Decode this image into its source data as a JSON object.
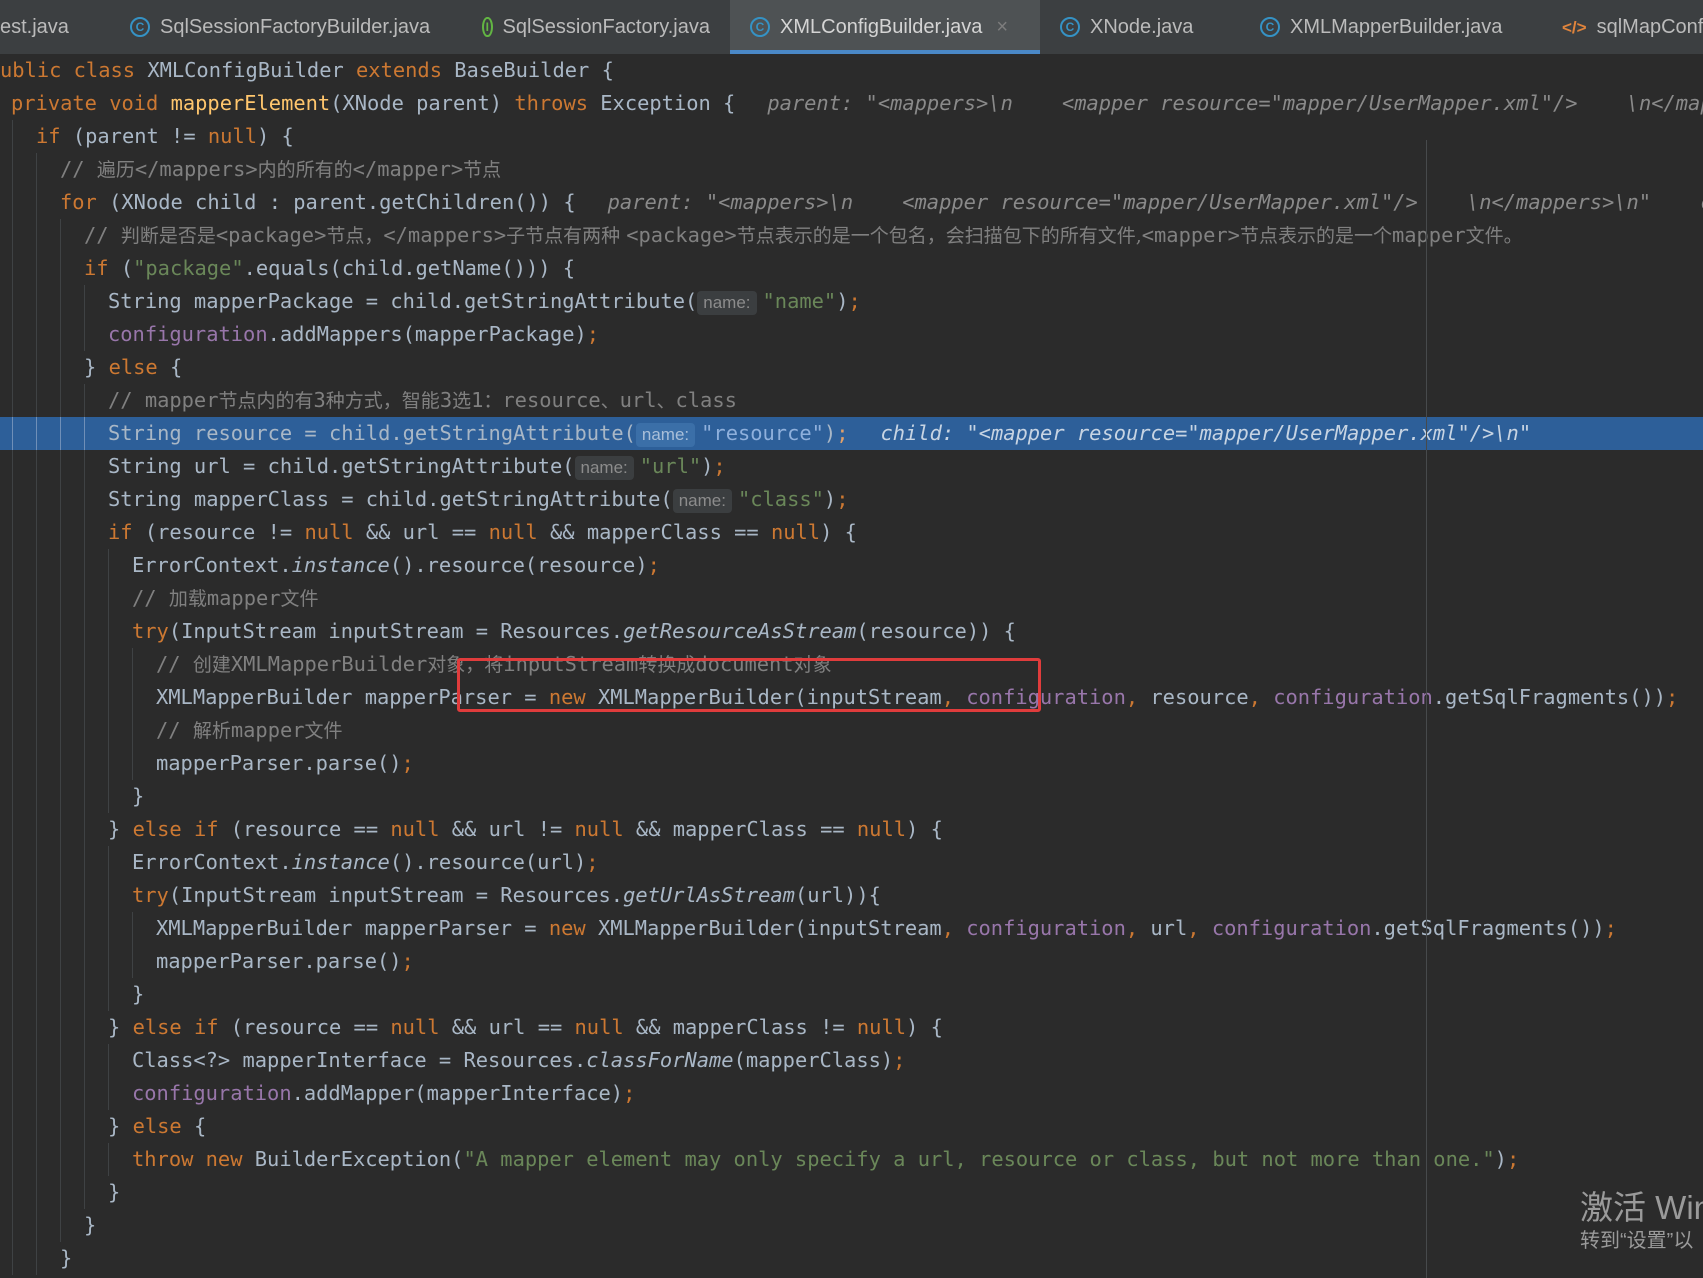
{
  "tabs": [
    {
      "label": "est.java",
      "icon": "none"
    },
    {
      "label": "SqlSessionFactoryBuilder.java",
      "icon": "class-icon"
    },
    {
      "label": "SqlSessionFactory.java",
      "icon": "interface-icon"
    },
    {
      "label": "XMLConfigBuilder.java",
      "icon": "class-icon",
      "active": true,
      "close": "×"
    },
    {
      "label": "XNode.java",
      "icon": "class-icon"
    },
    {
      "label": "XMLMapperBuilder.java",
      "icon": "class-icon"
    },
    {
      "label": "sqlMapConfig",
      "icon": "xml-icon"
    }
  ],
  "icon_glyphs": {
    "class-icon": "C",
    "interface-icon": "I",
    "xml-icon": "</>"
  },
  "highlight_color": "#2d5f99",
  "marker_color": "#e03c3c",
  "code_lines": [
    [
      [
        "kw",
        "ublic class "
      ],
      [
        "t",
        "XMLConfigBuilder "
      ],
      [
        "kw",
        "extends "
      ],
      [
        "t",
        "BaseBuilder {"
      ]
    ],
    [
      [
        "kw",
        "private void "
      ],
      [
        "fn",
        "mapperElement"
      ],
      [
        "t",
        "(XNode parent) "
      ],
      [
        "kw",
        "throws "
      ],
      [
        "t",
        "Exception {"
      ],
      [
        "inl",
        "parent: \"<mappers>\\n    <mapper resource=\"mapper/UserMapper.xml\"/>    \\n</mappers>\\n\""
      ]
    ],
    [
      [
        "kw",
        "if "
      ],
      [
        "t",
        "(parent != "
      ],
      [
        "kw",
        "null"
      ],
      [
        "t",
        ") {"
      ]
    ],
    [
      [
        "cm",
        "// "
      ],
      [
        "cmz",
        "遍历"
      ],
      [
        "cm",
        "</mappers>"
      ],
      [
        "cmz",
        "内的所有的"
      ],
      [
        "cm",
        "</mapper>"
      ],
      [
        "cmz",
        "节点"
      ]
    ],
    [
      [
        "kw",
        "for "
      ],
      [
        "t",
        "(XNode child : parent.getChildren()) {"
      ],
      [
        "inl",
        "parent: \"<mappers>\\n    <mapper resource=\"mapper/UserMapper.xml\"/>    \\n</mappers>\\n\"    child: \"<mapper resource=\"mapper/UserMapper.xml\"/>\\n\""
      ]
    ],
    [
      [
        "cm",
        "// "
      ],
      [
        "cmz",
        "判断是否是"
      ],
      [
        "cm",
        "<package>"
      ],
      [
        "cmz",
        "节点，"
      ],
      [
        "cm",
        "</mappers>"
      ],
      [
        "cmz",
        "子节点有两种 "
      ],
      [
        "cm",
        "<package>"
      ],
      [
        "cmz",
        "节点表示的是一个包名，会扫描包下的所有文件,"
      ],
      [
        "cm",
        "<mapper>"
      ],
      [
        "cmz",
        "节点表示的是一个"
      ],
      [
        "cm",
        "mapper"
      ],
      [
        "cmz",
        "文件。"
      ]
    ],
    [
      [
        "kw",
        "if "
      ],
      [
        "t",
        "("
      ],
      [
        "str",
        "\"package\""
      ],
      [
        "t",
        ".equals(child.getName())) {"
      ]
    ],
    [
      [
        "t",
        "String mapperPackage = child.getStringAttribute("
      ],
      [
        "ph",
        "name:"
      ],
      [
        "str",
        "\"name\""
      ],
      [
        "t",
        ")"
      ],
      [
        "kw",
        ";"
      ]
    ],
    [
      [
        "fld",
        "configuration"
      ],
      [
        "t",
        ".addMappers(mapperPackage)"
      ],
      [
        "kw",
        ";"
      ]
    ],
    [
      [
        "t",
        "} "
      ],
      [
        "kw",
        "else "
      ],
      [
        "t",
        "{"
      ]
    ],
    [
      [
        "cm",
        "// mapper"
      ],
      [
        "cmz",
        "节点内的有"
      ],
      [
        "cm",
        "3"
      ],
      [
        "cmz",
        "种方式，智能"
      ],
      [
        "cm",
        "3"
      ],
      [
        "cmz",
        "选"
      ],
      [
        "cm",
        "1"
      ],
      [
        "cmz",
        "："
      ],
      [
        "cm",
        "resource"
      ],
      [
        "cmz",
        "、"
      ],
      [
        "cm",
        "url"
      ],
      [
        "cmz",
        "、"
      ],
      [
        "cm",
        "class"
      ]
    ],
    [
      [
        "t",
        "String resource = child.getStringAttribute("
      ],
      [
        "ph",
        "name:"
      ],
      [
        "str",
        "\"resource\""
      ],
      [
        "t",
        ")"
      ],
      [
        "kw",
        ";"
      ],
      [
        "inl",
        "child: \"<mapper resource=\"mapper/UserMapper.xml\"/>\\n\""
      ]
    ],
    [
      [
        "t",
        "String url = child.getStringAttribute("
      ],
      [
        "ph",
        "name:"
      ],
      [
        "str",
        "\"url\""
      ],
      [
        "t",
        ")"
      ],
      [
        "kw",
        ";"
      ]
    ],
    [
      [
        "t",
        "String mapperClass = child.getStringAttribute("
      ],
      [
        "ph",
        "name:"
      ],
      [
        "str",
        "\"class\""
      ],
      [
        "t",
        ")"
      ],
      [
        "kw",
        ";"
      ]
    ],
    [
      [
        "kw",
        "if "
      ],
      [
        "t",
        "(resource != "
      ],
      [
        "kw",
        "null "
      ],
      [
        "t",
        "&& url == "
      ],
      [
        "kw",
        "null "
      ],
      [
        "t",
        "&& mapperClass == "
      ],
      [
        "kw",
        "null"
      ],
      [
        "t",
        ") {"
      ]
    ],
    [
      [
        "t",
        "ErrorContext."
      ],
      [
        "it",
        "instance"
      ],
      [
        "t",
        "().resource(resource)"
      ],
      [
        "kw",
        ";"
      ]
    ],
    [
      [
        "cm",
        "// "
      ],
      [
        "cmz",
        "加载"
      ],
      [
        "cm",
        "mapper"
      ],
      [
        "cmz",
        "文件"
      ]
    ],
    [
      [
        "kw",
        "try"
      ],
      [
        "t",
        "(InputStream inputStream = Resources."
      ],
      [
        "it",
        "getResourceAsStream"
      ],
      [
        "t",
        "(resource)) {"
      ]
    ],
    [
      [
        "cm",
        "// "
      ],
      [
        "cmz",
        "创建"
      ],
      [
        "cm",
        "XMLMapperBuilder"
      ],
      [
        "cmz",
        "对象，将"
      ],
      [
        "cm",
        "inputStream"
      ],
      [
        "cmz",
        "转换成"
      ],
      [
        "cm",
        "document"
      ],
      [
        "cmz",
        "对象"
      ]
    ],
    [
      [
        "t",
        "XMLMapperBuilder mapperParser = "
      ],
      [
        "kw",
        "new "
      ],
      [
        "t",
        "XMLMapperBuilder(inputStream"
      ],
      [
        "kw",
        ", "
      ],
      [
        "fld",
        "configuration"
      ],
      [
        "kw",
        ", "
      ],
      [
        "t",
        "resource"
      ],
      [
        "kw",
        ", "
      ],
      [
        "fld",
        "configuration"
      ],
      [
        "t",
        ".getSqlFragments())"
      ],
      [
        "kw",
        ";"
      ]
    ],
    [
      [
        "cm",
        "// "
      ],
      [
        "cmz",
        "解析"
      ],
      [
        "cm",
        "mapper"
      ],
      [
        "cmz",
        "文件"
      ]
    ],
    [
      [
        "t",
        "mapperParser.parse()"
      ],
      [
        "kw",
        ";"
      ]
    ],
    [
      [
        "t",
        "}"
      ]
    ],
    [
      [
        "t",
        "} "
      ],
      [
        "kw",
        "else if "
      ],
      [
        "t",
        "(resource == "
      ],
      [
        "kw",
        "null "
      ],
      [
        "t",
        "&& url != "
      ],
      [
        "kw",
        "null "
      ],
      [
        "t",
        "&& mapperClass == "
      ],
      [
        "kw",
        "null"
      ],
      [
        "t",
        ") {"
      ]
    ],
    [
      [
        "t",
        "ErrorContext."
      ],
      [
        "it",
        "instance"
      ],
      [
        "t",
        "().resource(url)"
      ],
      [
        "kw",
        ";"
      ]
    ],
    [
      [
        "kw",
        "try"
      ],
      [
        "t",
        "(InputStream inputStream = Resources."
      ],
      [
        "it",
        "getUrlAsStream"
      ],
      [
        "t",
        "(url)){"
      ]
    ],
    [
      [
        "t",
        "XMLMapperBuilder mapperParser = "
      ],
      [
        "kw",
        "new "
      ],
      [
        "t",
        "XMLMapperBuilder(inputStream"
      ],
      [
        "kw",
        ", "
      ],
      [
        "fld",
        "configuration"
      ],
      [
        "kw",
        ", "
      ],
      [
        "t",
        "url"
      ],
      [
        "kw",
        ", "
      ],
      [
        "fld",
        "configuration"
      ],
      [
        "t",
        ".getSqlFragments())"
      ],
      [
        "kw",
        ";"
      ]
    ],
    [
      [
        "t",
        "mapperParser.parse()"
      ],
      [
        "kw",
        ";"
      ]
    ],
    [
      [
        "t",
        "}"
      ]
    ],
    [
      [
        "t",
        "} "
      ],
      [
        "kw",
        "else if "
      ],
      [
        "t",
        "(resource == "
      ],
      [
        "kw",
        "null "
      ],
      [
        "t",
        "&& url == "
      ],
      [
        "kw",
        "null "
      ],
      [
        "t",
        "&& mapperClass != "
      ],
      [
        "kw",
        "null"
      ],
      [
        "t",
        ") {"
      ]
    ],
    [
      [
        "t",
        "Class<?> mapperInterface = Resources."
      ],
      [
        "it",
        "classForName"
      ],
      [
        "t",
        "(mapperClass)"
      ],
      [
        "kw",
        ";"
      ]
    ],
    [
      [
        "fld",
        "configuration"
      ],
      [
        "t",
        ".addMapper(mapperInterface)"
      ],
      [
        "kw",
        ";"
      ]
    ],
    [
      [
        "t",
        "} "
      ],
      [
        "kw",
        "else "
      ],
      [
        "t",
        "{"
      ]
    ],
    [
      [
        "kw",
        "throw new "
      ],
      [
        "t",
        "BuilderException("
      ],
      [
        "str",
        "\"A mapper element may only specify a url, resource or class, but not more than one.\""
      ],
      [
        "t",
        ")"
      ],
      [
        "kw",
        ";"
      ]
    ],
    [
      [
        "t",
        "}"
      ]
    ],
    [
      [
        "t",
        "}"
      ]
    ],
    [
      [
        "t",
        "}"
      ]
    ]
  ],
  "watermark": {
    "line1": "激活 Win",
    "line2": "转到“设置”以"
  }
}
